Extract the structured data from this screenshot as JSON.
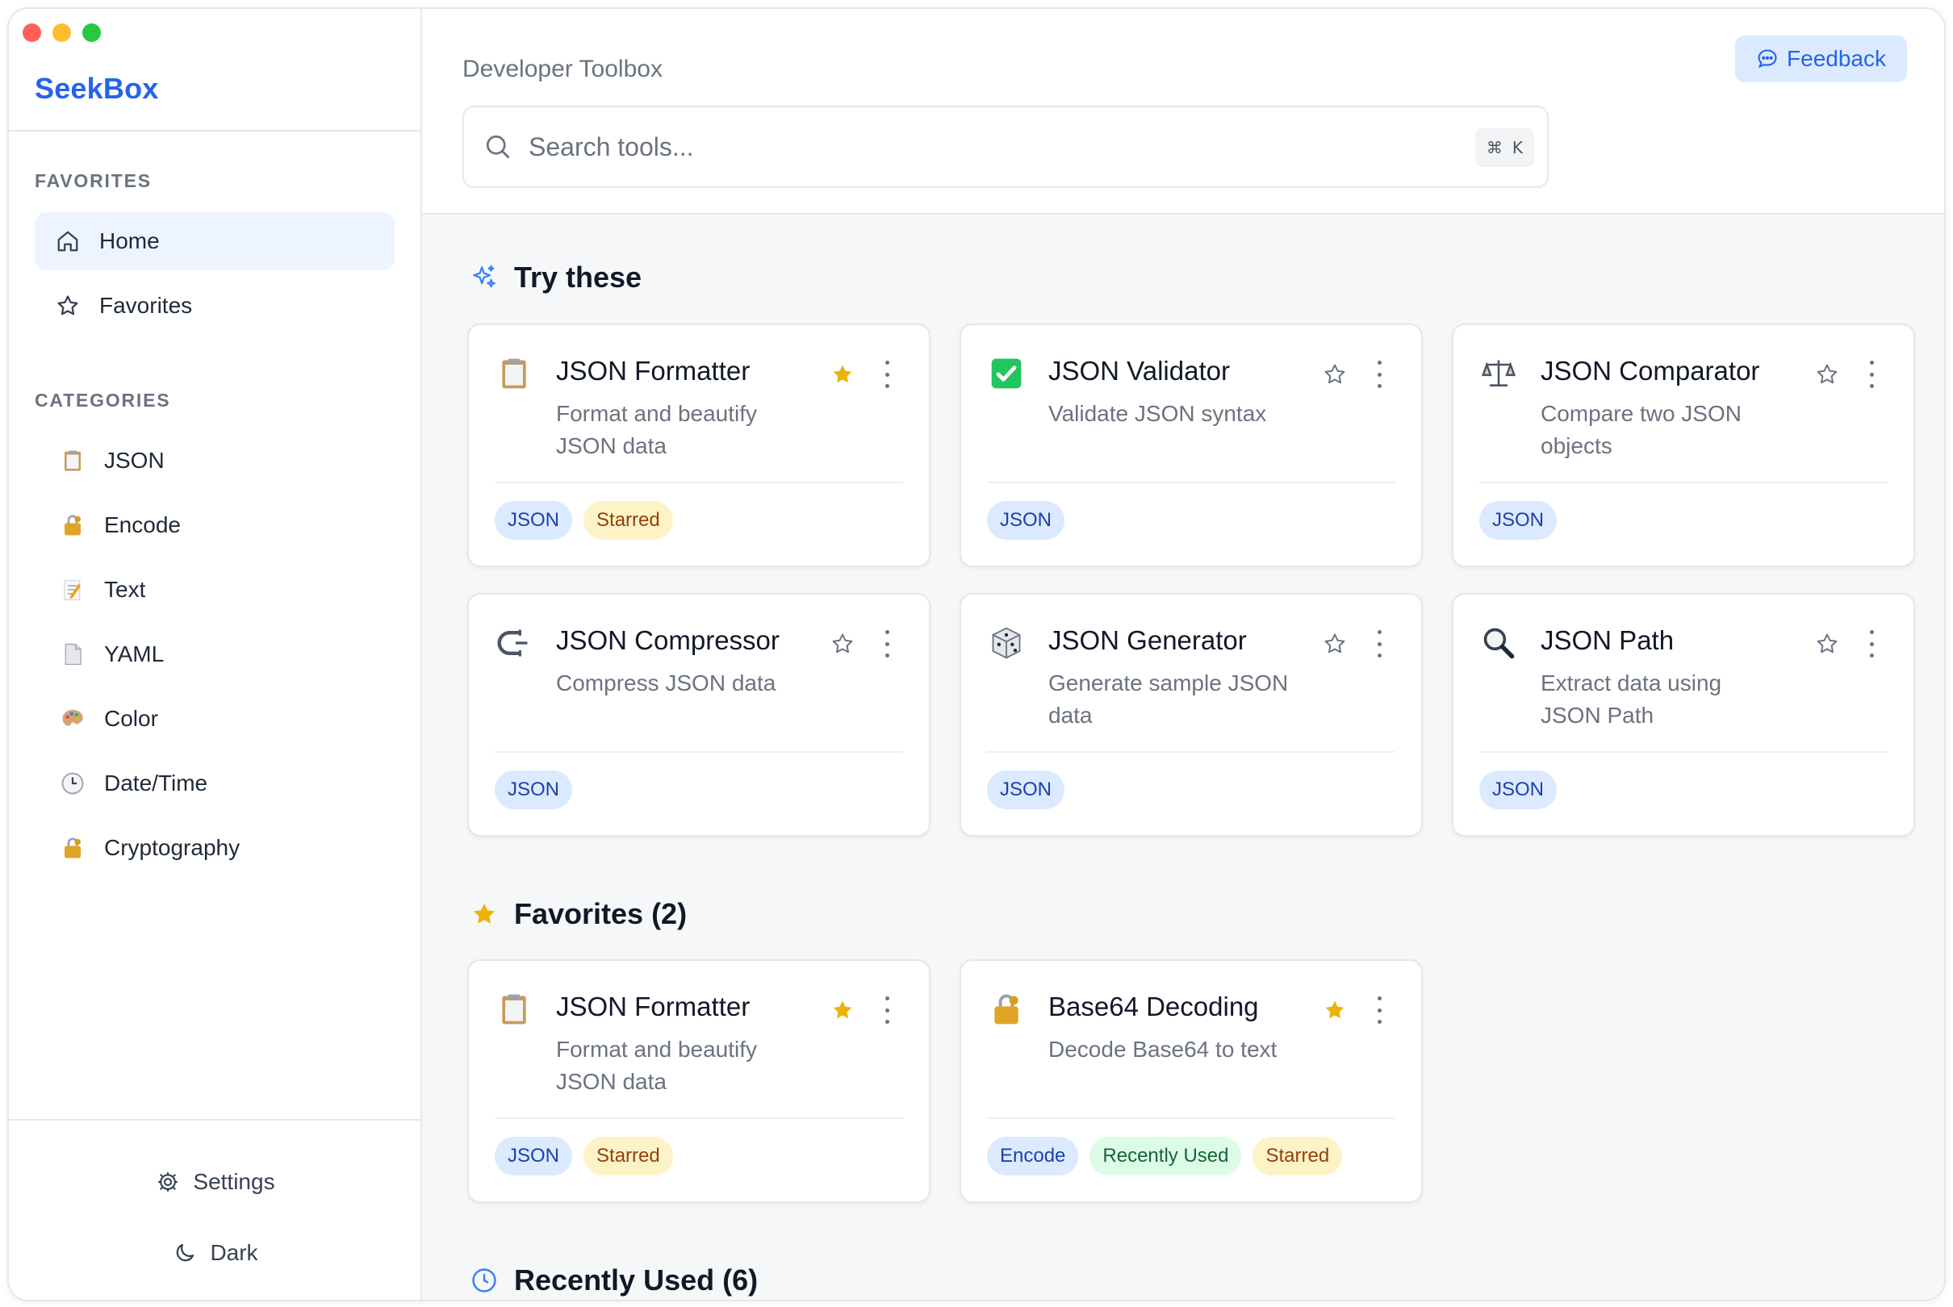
{
  "app": {
    "brand": "SeekBox",
    "page_title": "Developer Toolbox",
    "feedback_label": "Feedback"
  },
  "search": {
    "placeholder": "Search tools...",
    "value": "",
    "shortcut_symbol": "⌘",
    "shortcut_key": "K"
  },
  "sidebar": {
    "favorites_label": "FAVORITES",
    "nav": [
      {
        "label": "Home",
        "icon": "home-icon",
        "active": true
      },
      {
        "label": "Favorites",
        "icon": "star-outline-icon",
        "active": false
      }
    ],
    "categories_label": "CATEGORIES",
    "categories": [
      {
        "label": "JSON",
        "icon": "clipboard-icon"
      },
      {
        "label": "Encode",
        "icon": "lock-key-icon"
      },
      {
        "label": "Text",
        "icon": "memo-icon"
      },
      {
        "label": "YAML",
        "icon": "page-icon"
      },
      {
        "label": "Color",
        "icon": "palette-icon"
      },
      {
        "label": "Date/Time",
        "icon": "clock-icon"
      },
      {
        "label": "Cryptography",
        "icon": "lock-key-icon"
      }
    ],
    "settings_label": "Settings",
    "theme_label": "Dark"
  },
  "sections": {
    "try_these": "Try these",
    "favorites": "Favorites (2)",
    "recently_used": "Recently Used (6)"
  },
  "try_cards": [
    {
      "title": "JSON Formatter",
      "desc": "Format and beautify JSON data",
      "icon": "clipboard-icon",
      "starred": true,
      "tags": [
        "JSON",
        "Starred"
      ]
    },
    {
      "title": "JSON Validator",
      "desc": "Validate JSON syntax",
      "icon": "check-mark-icon",
      "starred": false,
      "tags": [
        "JSON"
      ]
    },
    {
      "title": "JSON Comparator",
      "desc": "Compare two JSON objects",
      "icon": "balance-scale-icon",
      "starred": false,
      "tags": [
        "JSON"
      ]
    },
    {
      "title": "JSON Compressor",
      "desc": "Compress JSON data",
      "icon": "clamp-icon",
      "starred": false,
      "tags": [
        "JSON"
      ]
    },
    {
      "title": "JSON Generator",
      "desc": "Generate sample JSON data",
      "icon": "dice-icon",
      "starred": false,
      "tags": [
        "JSON"
      ]
    },
    {
      "title": "JSON Path",
      "desc": "Extract data using JSON Path",
      "icon": "magnifier-icon",
      "starred": false,
      "tags": [
        "JSON"
      ]
    }
  ],
  "favorite_cards": [
    {
      "title": "JSON Formatter",
      "desc": "Format and beautify JSON data",
      "icon": "clipboard-icon",
      "starred": true,
      "tags": [
        "JSON",
        "Starred"
      ]
    },
    {
      "title": "Base64 Decoding",
      "desc": "Decode Base64 to text",
      "icon": "lock-key-icon",
      "starred": true,
      "tags": [
        "Encode",
        "Recently Used",
        "Starred"
      ]
    }
  ],
  "colors": {
    "accent": "#2563eb",
    "star": "#eab308",
    "tag_blue": "#dbeafe",
    "tag_yellow": "#fef3c7",
    "tag_green": "#dcfce7"
  }
}
